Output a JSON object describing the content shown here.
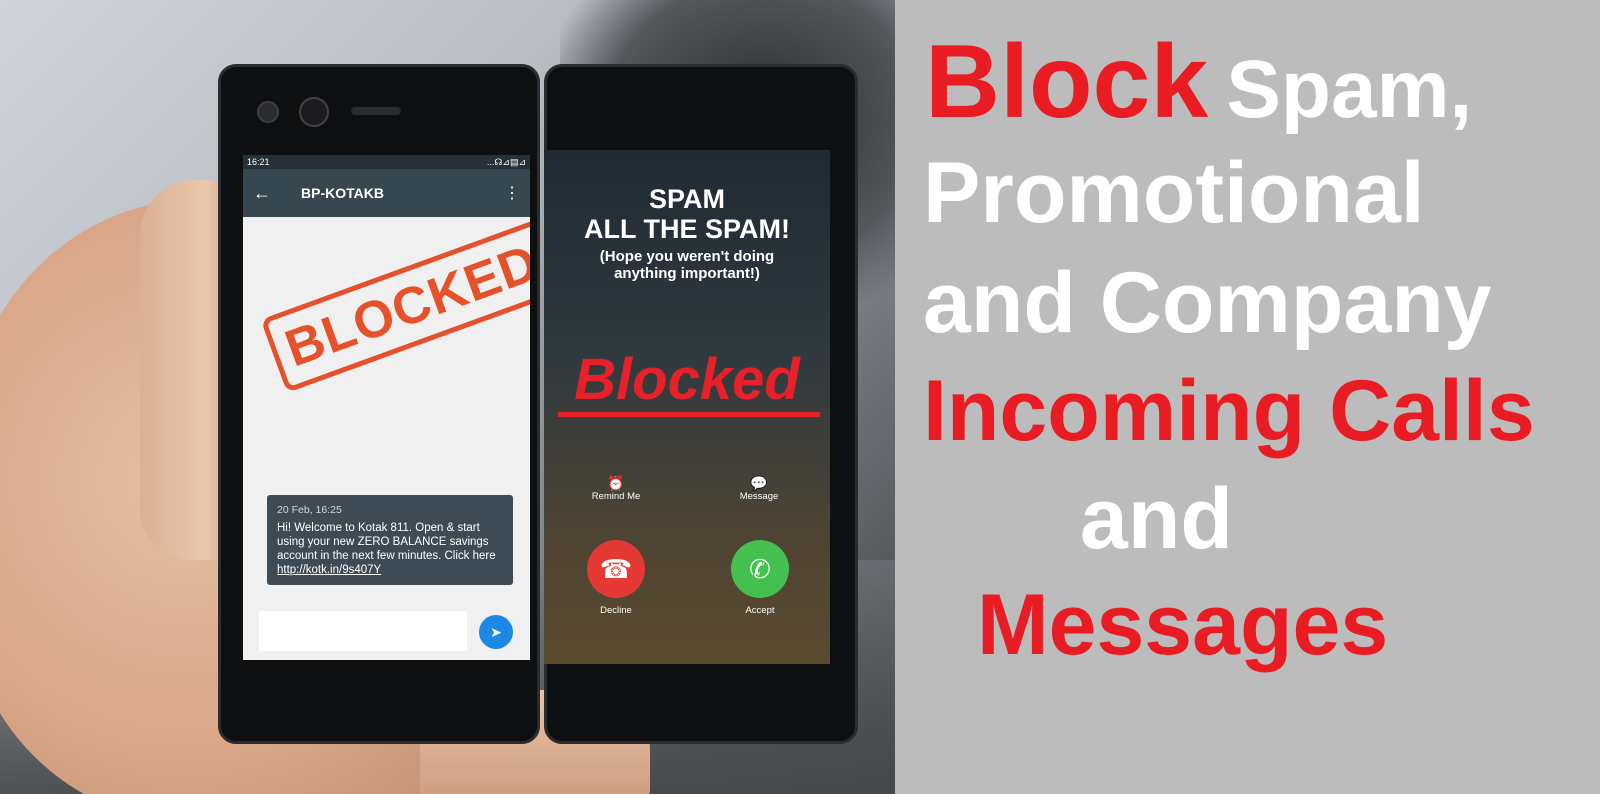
{
  "left_phone": {
    "status_time": "16:21",
    "status_icons": "...☊⊿▤⊿",
    "back_icon": "←",
    "contact": "BP-KOTAKB",
    "more_icon": "⋮",
    "stamp": "BLOCKED",
    "message_time": "20 Feb, 16:25",
    "message_text": "Hi! Welcome to Kotak 811. Open & start using your new ZERO BALANCE savings account in the next few minutes. Click here",
    "message_link": "http://kotk.in/9s407Y",
    "send_icon": "➤"
  },
  "right_phone": {
    "caller_title_1": "SPAM",
    "caller_title_2": "ALL THE SPAM!",
    "caller_sub_1": "(Hope you weren't doing",
    "caller_sub_2": "anything important!)",
    "blocked": "Blocked",
    "remind_icon": "⏰",
    "remind_label": "Remind Me",
    "message_icon": "💬",
    "message_label": "Message",
    "decline_icon": "☎",
    "decline_label": "Decline",
    "accept_icon": "✆",
    "accept_label": "Accept"
  },
  "headline": {
    "w1": "Block",
    "w2": "Spam,",
    "w3": "Promotional",
    "w4": "and Company",
    "w5": "Incoming Calls",
    "w6": "and",
    "w7": "Messages"
  },
  "colors": {
    "red": "#e91c24",
    "panel": "#bcbcbc",
    "decline": "#e53935",
    "accept": "#43c04e"
  }
}
